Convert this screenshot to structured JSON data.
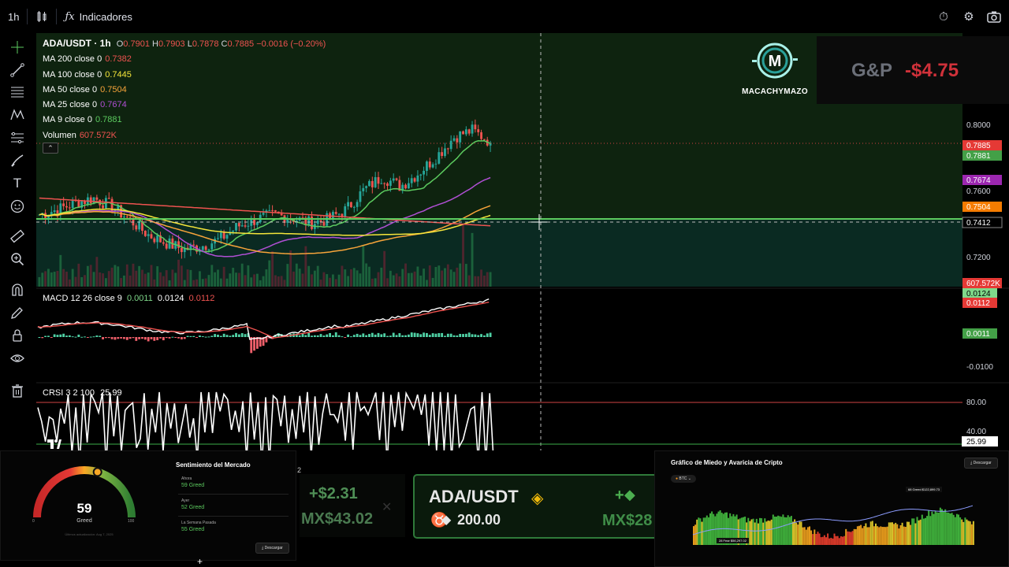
{
  "topbar": {
    "interval": "1h",
    "indicators_label": "Indicadores"
  },
  "symbol": {
    "title": "ADA/USDT · 1h",
    "o_label": "O",
    "o": "0.7901",
    "h_label": "H",
    "h": "0.7903",
    "l_label": "L",
    "l": "0.7878",
    "c_label": "C",
    "c": "0.7885",
    "change": "−0.0016 (−0.20%)"
  },
  "legend": [
    {
      "label": "MA 200 close 0",
      "value": "0.7382",
      "color": "#ef5350"
    },
    {
      "label": "MA 100 close 0",
      "value": "0.7445",
      "color": "#f5e53a"
    },
    {
      "label": "MA 50 close 0",
      "value": "0.7504",
      "color": "#f7a43a"
    },
    {
      "label": "MA 25 close 0",
      "value": "0.7674",
      "color": "#b04fd4"
    },
    {
      "label": "MA 9 close 0",
      "value": "0.7881",
      "color": "#5ccb5f"
    },
    {
      "label": "Volumen",
      "value": "607.572K",
      "color": "#ef5350"
    }
  ],
  "brand": {
    "name": "MACACHYMAZO"
  },
  "pnl": {
    "label": "G&P",
    "value": "-$4.75"
  },
  "price_axis": {
    "ticks": [
      "0.8000",
      "0.7600",
      "0.7200"
    ],
    "badges": [
      {
        "text": "0.7885",
        "color": "#e53935"
      },
      {
        "text": "0.7881",
        "color": "#43a047"
      },
      {
        "text": "0.7674",
        "color": "#9c27b0"
      },
      {
        "text": "0.7504",
        "color": "#f57c00"
      },
      {
        "text": "0.7412",
        "color": "#000000"
      },
      {
        "text": "607.572K",
        "color": "#e53935"
      }
    ]
  },
  "macd": {
    "title": "MACD 12 26 close 9",
    "v1": "0.0011",
    "v2": "0.0124",
    "v3": "0.0112",
    "axis_badges": [
      {
        "text": "0.0124",
        "color": "#7fd88a"
      },
      {
        "text": "0.0112",
        "color": "#e53935"
      },
      {
        "text": "0.0011",
        "color": "#43a047"
      }
    ],
    "tick": "-0.0100"
  },
  "crsi": {
    "title": "CRSI 3 2 100",
    "value": "25.99",
    "ticks": [
      "80.00",
      "40.00"
    ],
    "badge": "25.99"
  },
  "sentiment": {
    "title": "Sentimiento del Mercado",
    "gauge_value": "59",
    "gauge_label": "Greed",
    "gauge_fraction": 0.59,
    "min": "0",
    "max": "100",
    "updated": "Últimos actualización: Aug 7, 2025",
    "rows": [
      {
        "label": "Ahora",
        "value": "59 Greed"
      },
      {
        "label": "Ayer",
        "value": "52 Greed"
      },
      {
        "label": "La Semana Pasada",
        "value": "55 Greed"
      }
    ],
    "download": "Descargar"
  },
  "ticker": {
    "left_up": "+$2.31",
    "left_mxn": "MX$43.02",
    "symbol": "ADA/USDT",
    "amount": "200.00",
    "right_up": "+",
    "right_mxn": "MX$28",
    "edge_char": "2"
  },
  "fear_greed": {
    "title": "Gráfico de Miedo y Avaricia de Cripto",
    "coin": "BTC",
    "download": "Descargar",
    "annotation_top": "68 Greed $122,899.73",
    "annotation_bottom": "28 Fear $56,297.02"
  },
  "chart_data": {
    "type": "candlestick",
    "symbol": "ADA/USDT",
    "interval": "1h",
    "y_ticks": [
      0.8,
      0.76,
      0.72
    ],
    "last_close": 0.7885,
    "crosshair_price": 0.7412,
    "ma": {
      "MA200": 0.7382,
      "MA100": 0.7445,
      "MA50": 0.7504,
      "MA25": 0.7674,
      "MA9": 0.7881
    },
    "close_path_approx": [
      0.745,
      0.748,
      0.752,
      0.755,
      0.75,
      0.742,
      0.733,
      0.728,
      0.724,
      0.726,
      0.73,
      0.738,
      0.742,
      0.745,
      0.743,
      0.74,
      0.742,
      0.748,
      0.76,
      0.768,
      0.762,
      0.77,
      0.78,
      0.792,
      0.796,
      0.789
    ],
    "rsi_band": [
      40,
      80
    ],
    "rsi_last": 25.99
  }
}
